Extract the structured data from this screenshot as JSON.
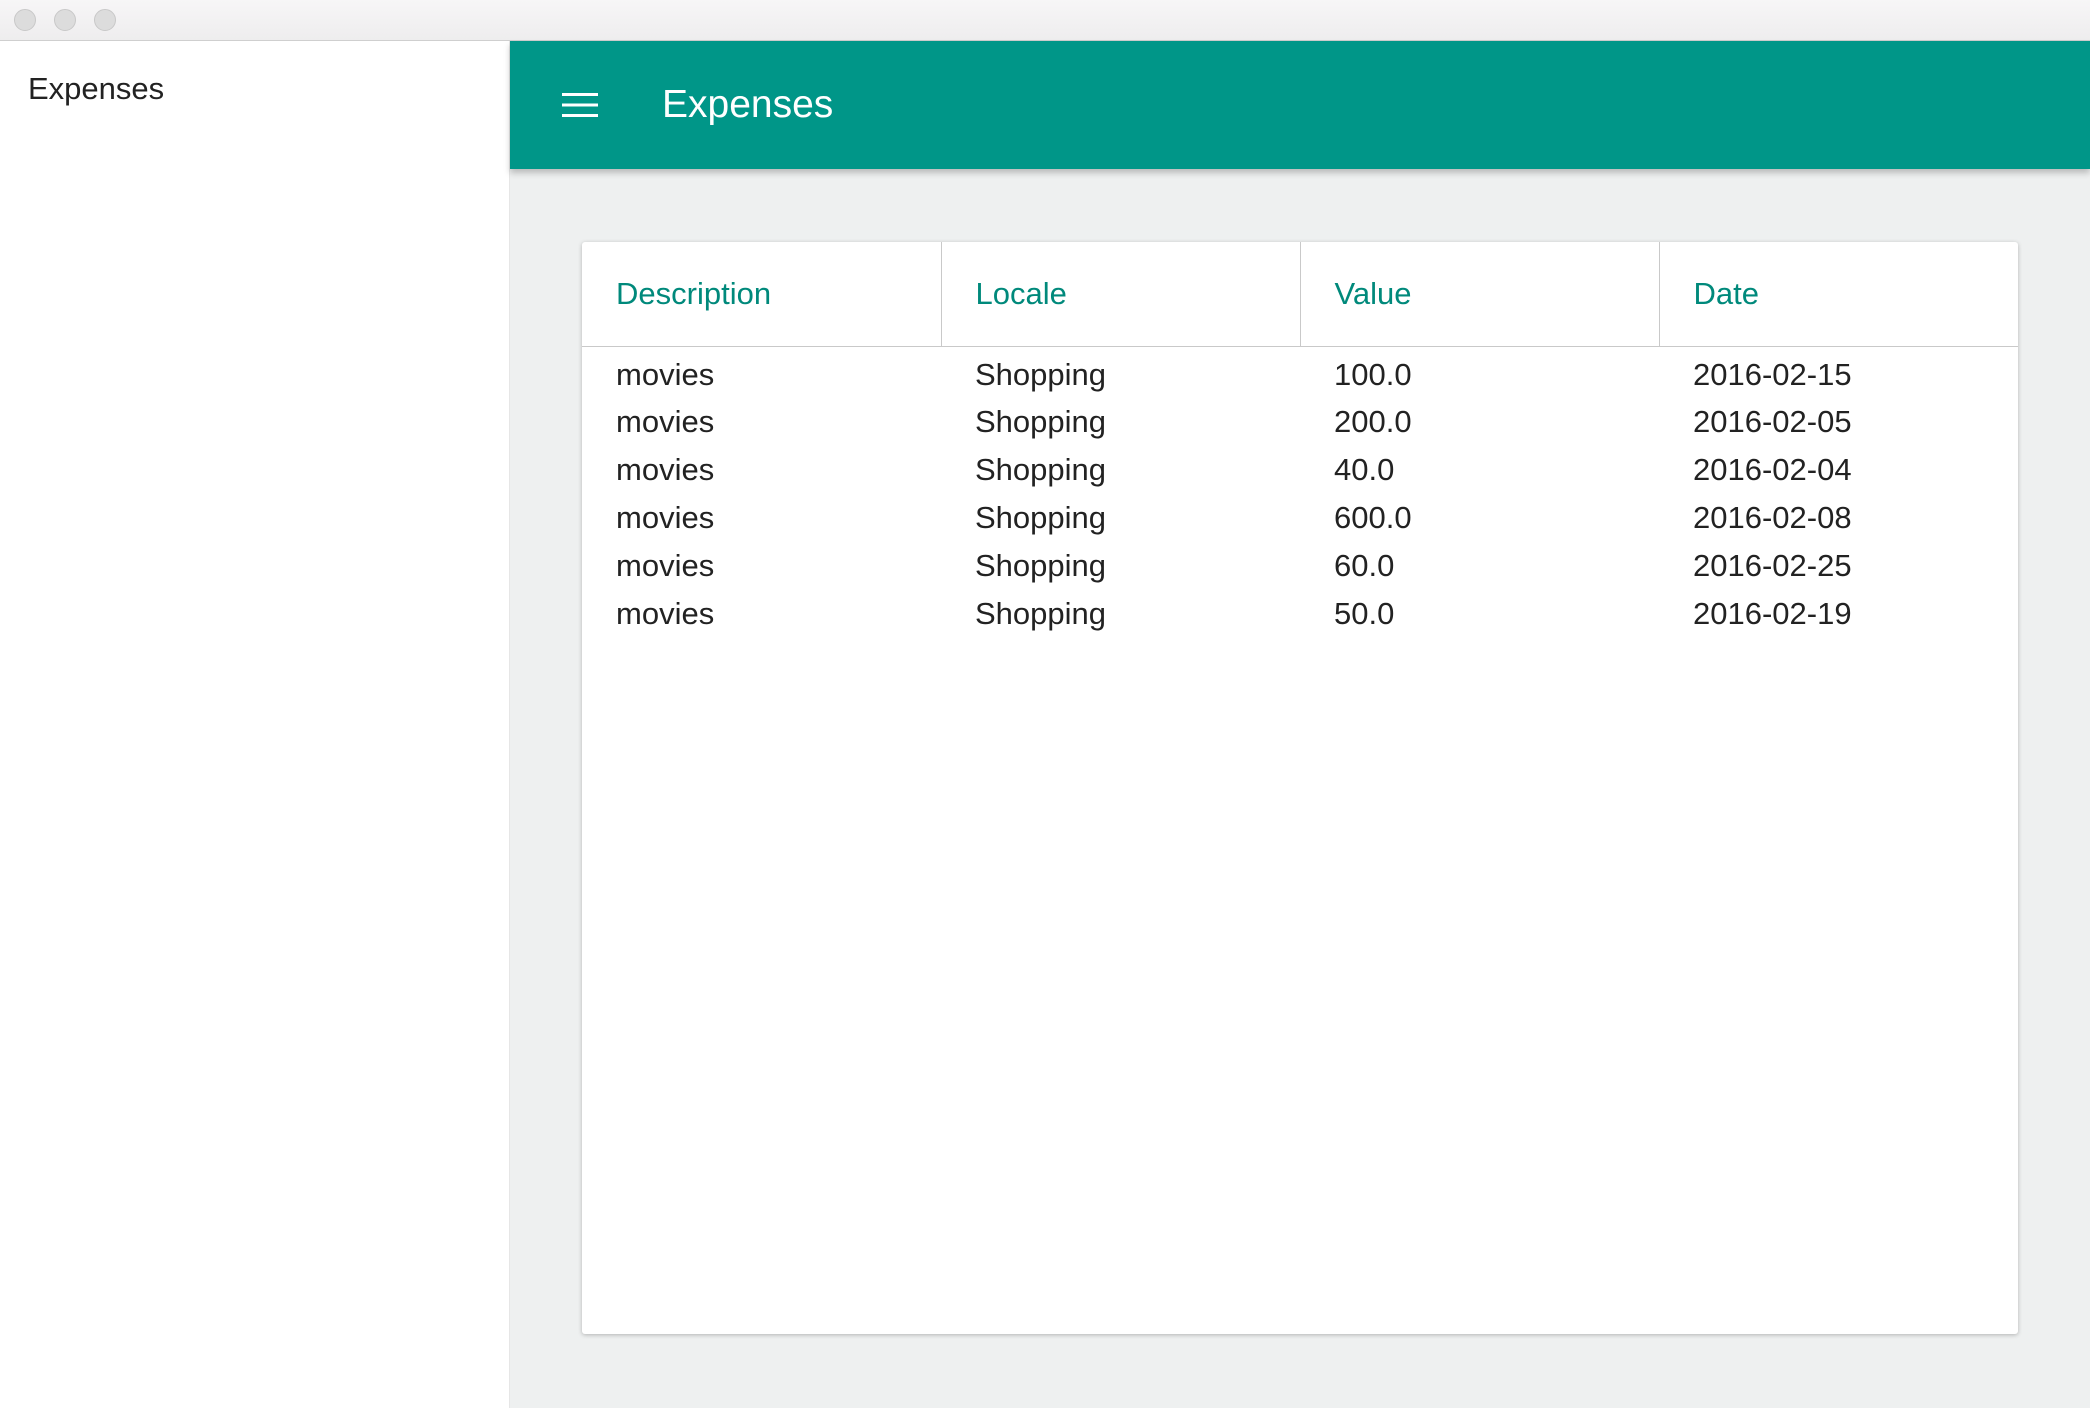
{
  "sidebar": {
    "title": "Expenses"
  },
  "appbar": {
    "title": "Expenses",
    "menu_icon": "hamburger-menu-icon",
    "background_color": "#009688"
  },
  "table": {
    "columns": [
      "Description",
      "Locale",
      "Value",
      "Date"
    ],
    "rows": [
      [
        "movies",
        "Shopping",
        "100.0",
        "2016-02-15"
      ],
      [
        "movies",
        "Shopping",
        "200.0",
        "2016-02-05"
      ],
      [
        "movies",
        "Shopping",
        "40.0",
        "2016-02-04"
      ],
      [
        "movies",
        "Shopping",
        "600.0",
        "2016-02-08"
      ],
      [
        "movies",
        "Shopping",
        "60.0",
        "2016-02-25"
      ],
      [
        "movies",
        "Shopping",
        "50.0",
        "2016-02-19"
      ]
    ],
    "header_color": "#00897b"
  }
}
